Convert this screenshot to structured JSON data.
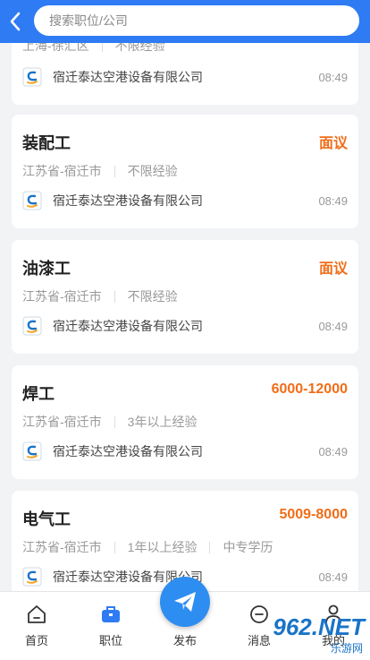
{
  "search": {
    "placeholder": "搜索职位/公司"
  },
  "partial_card": {
    "meta": [
      "上海-徐汇区",
      "不限经验"
    ],
    "company": "宿迁泰达空港设备有限公司",
    "time": "08:49"
  },
  "jobs": [
    {
      "title": "装配工",
      "salary": "面议",
      "location": "江苏省-宿迁市",
      "experience": "不限经验",
      "company": "宿迁泰达空港设备有限公司",
      "time": "08:49"
    },
    {
      "title": "油漆工",
      "salary": "面议",
      "location": "江苏省-宿迁市",
      "experience": "不限经验",
      "company": "宿迁泰达空港设备有限公司",
      "time": "08:49"
    },
    {
      "title": "焊工",
      "salary": "6000-12000",
      "location": "江苏省-宿迁市",
      "experience": "3年以上经验",
      "company": "宿迁泰达空港设备有限公司",
      "time": "08:49"
    },
    {
      "title": "电气工",
      "salary": "5009-8000",
      "location": "江苏省-宿迁市",
      "experience": "1年以上经验",
      "education": "中专学历",
      "company": "宿迁泰达空港设备有限公司",
      "time": "08:49"
    }
  ],
  "nav": {
    "home": "首页",
    "jobs": "职位",
    "publish": "发布",
    "messages": "消息",
    "mine": "我的"
  },
  "watermark": {
    "brand": "962.NET",
    "sub": "乐游网"
  },
  "colors": {
    "primary": "#2f7bf3",
    "salary": "#f16d18",
    "active_tab": "#2f7bf3"
  }
}
